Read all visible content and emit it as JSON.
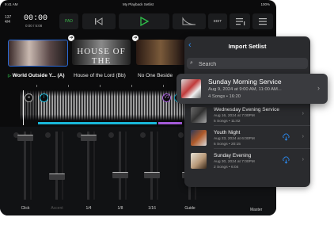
{
  "status_bar": {
    "time": "9:41 AM",
    "title": "My Playback Setlist",
    "battery": "100%"
  },
  "transport": {
    "tempo": "137",
    "time_signature": "4/4",
    "clock": "00:00",
    "clock_sub": "0:00 / 5:08",
    "pad_label": "PAD",
    "edit_label": "EDIT"
  },
  "songs": [
    {
      "title": "World Outside Y... (A)",
      "thumb_text": "",
      "active": true
    },
    {
      "title": "House of the Lord (Bb)",
      "thumb_text": "HOUSE OF THE",
      "active": false
    },
    {
      "title": "No One Beside",
      "thumb_text": "",
      "active": false
    }
  ],
  "markers": [
    "I",
    "V1",
    "I",
    "V1"
  ],
  "mixer": {
    "channels": [
      {
        "label": "Click",
        "dim": false,
        "level": 0.95
      },
      {
        "label": "Accent",
        "dim": true,
        "level": 0.32
      },
      {
        "label": "1/4",
        "dim": false,
        "level": 0.95
      },
      {
        "label": "1/8",
        "dim": false,
        "level": 0.35
      },
      {
        "label": "1/16",
        "dim": false,
        "level": 0.35
      },
      {
        "label": "Guide",
        "dim": false,
        "level": 0.35
      }
    ],
    "master_label": "Master"
  },
  "import_panel": {
    "title": "Import Setlist",
    "search_placeholder": "Search",
    "items": [
      {
        "name": "Sunday Morning Service",
        "date": "Aug 9, 2024 at 9:00 AM, 11:00 AM...",
        "meta": "4 Songs • 16:20",
        "highlighted": true,
        "cloud": false
      },
      {
        "name": "Wednesday Evening Service",
        "date": "Aug 16, 2024 at 7:00PM",
        "meta": "5 Songs • 11:02",
        "highlighted": false,
        "cloud": false
      },
      {
        "name": "Youth Night",
        "date": "Aug 23, 2024 at 6:00PM",
        "meta": "5 Songs • 20:15",
        "highlighted": false,
        "cloud": true
      },
      {
        "name": "Sunday Evening",
        "date": "Aug 30, 2024 at 7:00PM",
        "meta": "2 Songs • 6:04",
        "highlighted": false,
        "cloud": true
      }
    ]
  },
  "colors": {
    "accent": "#2a8af0",
    "play_green": "#2fbf4a",
    "marker_cyan": "#19b6d8",
    "marker_purple": "#a35ad8"
  }
}
